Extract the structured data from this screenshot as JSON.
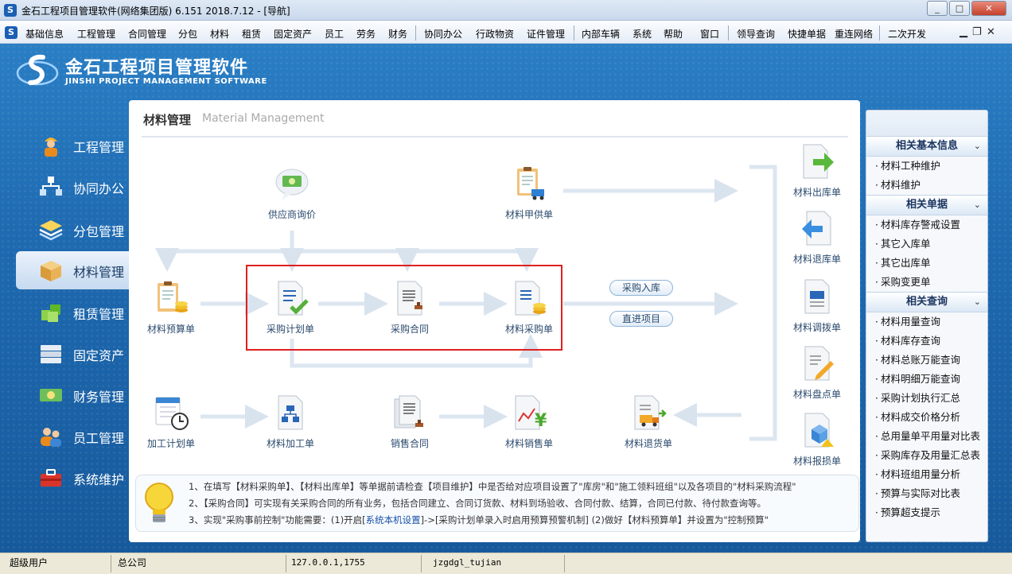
{
  "window": {
    "title": "金石工程项目管理软件(网络集团版) 6.151  2018.7.12 - [导航]",
    "minimize_label": "_",
    "maximize_label": "□",
    "close_label": "✕"
  },
  "menu": {
    "items": [
      "基础信息",
      "工程管理",
      "合同管理",
      "分包",
      "材料",
      "租赁",
      "固定资产",
      "员工",
      "劳务",
      "财务",
      "协同办公",
      "行政物资",
      "证件管理",
      "内部车辆",
      "系统",
      "帮助",
      "窗口",
      "领导查询",
      "快捷单据",
      "重连网络",
      "二次开发"
    ],
    "mdi_controls": [
      "▁",
      "❐",
      "✕"
    ]
  },
  "brand": {
    "title": "金石工程项目管理软件",
    "subtitle": "JINSHI PROJECT MANAGEMENT SOFTWARE"
  },
  "nav": {
    "items": [
      {
        "label": "工程管理",
        "icon": "worker-icon"
      },
      {
        "label": "协同办公",
        "icon": "network-icon"
      },
      {
        "label": "分包管理",
        "icon": "layers-icon"
      },
      {
        "label": "材料管理",
        "icon": "box-icon",
        "active": true
      },
      {
        "label": "租赁管理",
        "icon": "cubes-icon"
      },
      {
        "label": "固定资产",
        "icon": "server-icon"
      },
      {
        "label": "财务管理",
        "icon": "money-icon"
      },
      {
        "label": "员工管理",
        "icon": "people-icon"
      },
      {
        "label": "系统维护",
        "icon": "toolbox-icon"
      }
    ]
  },
  "panel": {
    "title": "材料管理",
    "title_en": "Material Management"
  },
  "diagram": {
    "nodes": {
      "supplier_inquiry": "供应商询价",
      "owner_supply": "材料甲供单",
      "budget": "材料预算单",
      "purchase_plan": "采购计划单",
      "purchase_contract": "采购合同",
      "purchase_order": "材料采购单",
      "outbound": "材料出库单",
      "return_stock": "材料退库单",
      "transfer": "材料调拨单",
      "inventory": "材料盘点单",
      "damage": "材料报损单",
      "processing_plan": "加工计划单",
      "processing": "材料加工单",
      "sales_contract": "销售合同",
      "sales": "材料销售单",
      "return_goods": "材料退货单"
    },
    "pills": {
      "purchase_in": "采购入库",
      "direct_project": "直进项目"
    }
  },
  "tips": {
    "line1": "1、在填写【材料采购单】、【材料出库单】等单据前请检查【项目维护】中是否给对应项目设置了\"库房\"和\"施工领料班组\"以及各项目的\"材料采购流程\"",
    "line2": "2、【采购合同】可实现有关采购合同的所有业务，包括合同建立、合同订货款、材料到场验收、合同付款、结算，合同已付款、待付款查询等。",
    "line3_a": "3、实现\"采购事前控制\"功能需要：(1)开启[",
    "line3_link": "系统本机设置",
    "line3_b": "]->[采购计划单录入时启用预算预警机制]  (2)做好【材料预算单】并设置为\"控制预算\""
  },
  "sidebar": {
    "sections": [
      {
        "title": "相关基本信息",
        "items": [
          "材料工种维护",
          "材料维护"
        ]
      },
      {
        "title": "相关单据",
        "items": [
          "材料库存警戒设置",
          "其它入库单",
          "其它出库单",
          "采购变更单"
        ]
      },
      {
        "title": "相关查询",
        "items": [
          "材料用量查询",
          "材料库存查询",
          "材料总账万能查询",
          "材料明细万能查询",
          "采购计划执行汇总",
          "材料成交价格分析",
          "总用量单平用量对比表",
          "采购库存及用量汇总表",
          "材料班组用量分析",
          "预算与实际对比表",
          "预算超支提示"
        ]
      }
    ],
    "chevron": "⌄"
  },
  "status": {
    "user": "超级用户",
    "company": "总公司",
    "address": "127.0.0.1,1755",
    "db": "jzgdgl_tujian"
  }
}
